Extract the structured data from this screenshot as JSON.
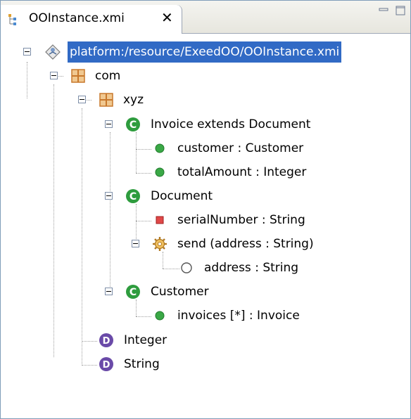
{
  "tab": {
    "title": "OOInstance.xmi",
    "close_glyph": "✕"
  },
  "tree": {
    "root": "platform:/resource/ExeedOO/OOInstance.xmi",
    "com": "com",
    "xyz": "xyz",
    "invoice": "Invoice extends Document",
    "invoice_customer": "customer  : Customer",
    "invoice_totalAmount": "totalAmount  : Integer",
    "document": "Document",
    "document_serialNumber": "serialNumber  : String",
    "document_send": "send (address : String)",
    "send_address": "address : String",
    "customer": "Customer",
    "customer_invoices": "invoices [*]  : Invoice",
    "integer": "Integer",
    "string": "String"
  },
  "colors": {
    "selection": "#316ac5",
    "class_green": "#2e9c3e",
    "datatype_purple": "#6a4aa8",
    "package_orange": "#c8782c",
    "attribute_green": "#3aa846",
    "private_red": "#d43c3c"
  }
}
